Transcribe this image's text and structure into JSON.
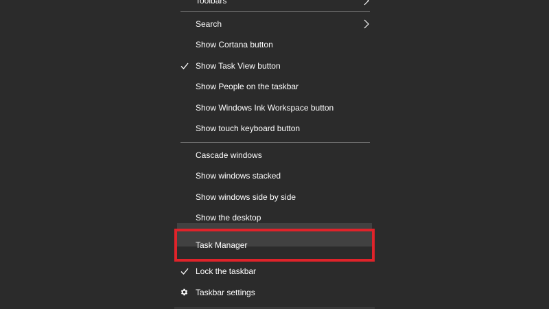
{
  "colors": {
    "menu_bg": "#2b2b2b",
    "hover_bg": "#414141",
    "separator": "#6b6b6b",
    "highlight_border": "#e0232a",
    "text": "#ffffff"
  },
  "menu": {
    "toolbars_label": "Toolbars",
    "search_label": "Search",
    "cortana_label": "Show Cortana button",
    "task_view_label": "Show Task View button",
    "people_label": "Show People on the taskbar",
    "ink_label": "Show Windows Ink Workspace button",
    "touch_keyboard_label": "Show touch keyboard button",
    "cascade_label": "Cascade windows",
    "stacked_label": "Show windows stacked",
    "side_by_side_label": "Show windows side by side",
    "desktop_label": "Show the desktop",
    "task_manager_label": "Task Manager",
    "lock_label": "Lock the taskbar",
    "settings_label": "Taskbar settings"
  },
  "icons": {
    "submenu": "chevron-right-icon",
    "checked": "checkmark-icon",
    "settings": "gear-icon"
  },
  "state": {
    "task_view_checked": true,
    "lock_taskbar_checked": true,
    "hovered_item": "Task Manager"
  }
}
